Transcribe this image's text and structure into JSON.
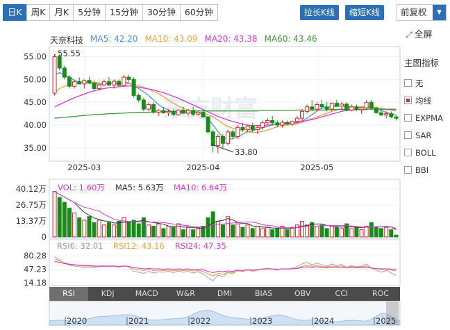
{
  "toolbar": {
    "periods": [
      "日K",
      "周K",
      "月K",
      "5分钟",
      "15分钟",
      "30分钟",
      "60分钟"
    ],
    "active_period": "日K",
    "widen_label": "拉长K线",
    "narrow_label": "缩短K线",
    "adjust_label": "前复权",
    "fullscreen_label": "全屏"
  },
  "stock": {
    "name": "天奈科技",
    "ma5": "MA5: 42.20",
    "ma10": "MA10: 43.09",
    "ma20": "MA20: 43.38",
    "ma60": "MA60: 43.46"
  },
  "colors": {
    "up": "#d62728",
    "down": "#1a8a1a",
    "ma5": "#4a90d9",
    "ma10": "#e8a33d",
    "ma20": "#d63ad6",
    "ma60": "#3a9a3a",
    "accent": "#2b6fb6"
  },
  "indicators_panel": {
    "title": "主图指标",
    "items": [
      {
        "label": "无",
        "checked": false
      },
      {
        "label": "均线",
        "checked": true
      },
      {
        "label": "EXPMA",
        "checked": false
      },
      {
        "label": "SAR",
        "checked": false
      },
      {
        "label": "BOLL",
        "checked": false
      },
      {
        "label": "BBI",
        "checked": false
      }
    ]
  },
  "price_axis": {
    "ticks": [
      "55.00",
      "50.00",
      "45.00",
      "40.00",
      "35.00"
    ]
  },
  "date_axis": {
    "ticks": [
      "2025-03",
      "2025-04",
      "2025-05"
    ]
  },
  "annotations": {
    "high": "55.55",
    "low": "33.80"
  },
  "volume": {
    "vol": "VOL: 1.60万",
    "ma5": "MA5: 5.63万",
    "ma10": "MA10: 6.64万",
    "ticks": [
      "40.12万",
      "26.75万",
      "13.37万",
      "0"
    ]
  },
  "rsi": {
    "rsi6": "RSI6: 32.01",
    "rsi12": "RSI12: 43.16",
    "rsi24": "RSI24: 47.35",
    "ticks": [
      "80.28",
      "47.23",
      "14.18"
    ]
  },
  "indicator_tabs": [
    "RSI",
    "KDJ",
    "MACD",
    "W&R",
    "DMI",
    "BIAS",
    "OBV",
    "CCI",
    "ROC"
  ],
  "active_indicator": "RSI",
  "timeline": {
    "years": [
      "2020",
      "2021",
      "2022",
      "2023",
      "2024",
      "2025"
    ]
  },
  "watermark": "东方财富",
  "chart_data": {
    "type": "candlestick",
    "title": "天奈科技",
    "ylim": [
      33,
      56
    ],
    "xlabels": [
      "2025-03",
      "2025-04",
      "2025-05"
    ],
    "ohlc": [
      [
        47.0,
        55.5,
        46.5,
        55.0
      ],
      [
        55.0,
        55.55,
        52.0,
        52.5
      ],
      [
        52.5,
        53.0,
        50.0,
        50.5
      ],
      [
        50.5,
        51.0,
        48.0,
        48.5
      ],
      [
        48.5,
        50.0,
        48.0,
        49.5
      ],
      [
        49.5,
        50.5,
        49.0,
        49.0
      ],
      [
        49.0,
        50.0,
        48.0,
        49.8
      ],
      [
        49.8,
        50.5,
        49.0,
        49.2
      ],
      [
        49.2,
        49.8,
        47.5,
        48.0
      ],
      [
        48.0,
        49.0,
        47.5,
        48.8
      ],
      [
        48.8,
        50.0,
        48.5,
        49.5
      ],
      [
        49.5,
        50.5,
        48.5,
        48.8
      ],
      [
        48.8,
        50.0,
        48.0,
        49.6
      ],
      [
        49.6,
        50.0,
        48.5,
        48.7
      ],
      [
        48.7,
        51.0,
        48.5,
        50.5
      ],
      [
        50.5,
        51.0,
        49.5,
        50.0
      ],
      [
        50.0,
        50.5,
        46.0,
        46.5
      ],
      [
        46.5,
        47.0,
        45.0,
        45.5
      ],
      [
        45.5,
        46.0,
        43.0,
        43.5
      ],
      [
        43.5,
        45.0,
        43.0,
        44.5
      ],
      [
        44.5,
        45.0,
        42.5,
        42.8
      ],
      [
        42.8,
        43.5,
        42.0,
        43.2
      ],
      [
        43.2,
        44.0,
        42.5,
        42.7
      ],
      [
        42.7,
        43.5,
        42.0,
        43.0
      ],
      [
        43.0,
        43.5,
        42.0,
        42.3
      ],
      [
        42.3,
        43.5,
        42.0,
        43.3
      ],
      [
        43.3,
        44.0,
        42.5,
        42.6
      ],
      [
        42.6,
        43.5,
        42.0,
        43.2
      ],
      [
        43.2,
        44.0,
        42.0,
        42.4
      ],
      [
        42.4,
        43.0,
        42.0,
        42.8
      ],
      [
        42.8,
        43.5,
        41.5,
        41.8
      ],
      [
        41.8,
        42.0,
        38.0,
        38.5
      ],
      [
        38.5,
        39.0,
        34.0,
        35.5
      ],
      [
        35.5,
        38.0,
        33.8,
        37.5
      ],
      [
        37.5,
        38.0,
        35.0,
        36.0
      ],
      [
        36.0,
        39.0,
        35.5,
        38.5
      ],
      [
        38.5,
        39.0,
        37.0,
        37.5
      ],
      [
        37.5,
        40.0,
        37.0,
        39.5
      ],
      [
        39.5,
        40.5,
        38.5,
        39.0
      ],
      [
        39.0,
        40.0,
        38.5,
        39.8
      ],
      [
        39.8,
        40.5,
        38.5,
        39.0
      ],
      [
        39.0,
        40.0,
        38.0,
        39.5
      ],
      [
        39.5,
        41.0,
        39.0,
        40.5
      ],
      [
        40.5,
        41.5,
        40.0,
        41.0
      ],
      [
        41.0,
        42.0,
        40.0,
        40.5
      ],
      [
        40.5,
        41.0,
        39.5,
        40.0
      ],
      [
        40.0,
        41.0,
        39.5,
        40.6
      ],
      [
        40.6,
        41.0,
        40.0,
        40.2
      ],
      [
        40.2,
        41.0,
        39.8,
        40.8
      ],
      [
        40.8,
        42.0,
        40.5,
        41.5
      ],
      [
        41.5,
        43.5,
        41.0,
        43.0
      ],
      [
        43.0,
        44.5,
        42.5,
        44.0
      ],
      [
        44.0,
        45.5,
        43.0,
        43.5
      ],
      [
        43.5,
        45.0,
        43.0,
        44.5
      ],
      [
        44.5,
        45.5,
        43.5,
        44.0
      ],
      [
        44.0,
        45.0,
        43.0,
        43.5
      ],
      [
        43.5,
        45.0,
        43.0,
        44.8
      ],
      [
        44.8,
        45.5,
        44.0,
        44.2
      ],
      [
        44.2,
        45.0,
        43.5,
        44.6
      ],
      [
        44.6,
        45.0,
        43.0,
        43.3
      ],
      [
        43.3,
        44.5,
        43.0,
        44.0
      ],
      [
        44.0,
        44.5,
        43.0,
        43.4
      ],
      [
        43.4,
        44.0,
        42.5,
        43.8
      ],
      [
        43.8,
        45.5,
        43.5,
        45.0
      ],
      [
        45.0,
        45.5,
        43.5,
        43.7
      ],
      [
        43.7,
        44.0,
        42.5,
        42.7
      ],
      [
        42.7,
        43.5,
        42.0,
        42.2
      ],
      [
        42.2,
        43.0,
        41.5,
        42.5
      ],
      [
        42.5,
        43.0,
        41.5,
        41.8
      ],
      [
        41.8,
        42.2,
        41.0,
        41.5
      ]
    ],
    "series": [
      {
        "name": "MA5",
        "values": [
          51,
          51.5,
          51,
          50.5,
          49.8,
          49.5,
          49.3,
          49.2,
          49.1,
          49.0,
          49.0,
          49.1,
          49.1,
          49.1,
          49.3,
          49.3,
          48.6,
          48.0,
          47.3,
          46.5,
          45.5,
          44.5,
          43.8,
          43.3,
          42.9,
          42.8,
          42.8,
          42.8,
          42.8,
          42.7,
          42.5,
          41.5,
          40.0,
          38.6,
          37.3,
          36.9,
          37.0,
          37.5,
          38.0,
          38.5,
          38.8,
          39.1,
          39.4,
          39.7,
          40.0,
          40.2,
          40.4,
          40.5,
          40.4,
          40.5,
          40.9,
          41.5,
          42.3,
          43.1,
          43.7,
          43.9,
          44.0,
          44.1,
          44.2,
          44.1,
          44.0,
          43.9,
          43.8,
          43.9,
          43.9,
          43.6,
          43.2,
          42.8,
          42.5,
          42.2
        ]
      },
      {
        "name": "MA10",
        "values": [
          47,
          48,
          48.5,
          49,
          49.2,
          49.4,
          49.5,
          49.5,
          49.4,
          49.3,
          49.2,
          49.2,
          49.2,
          49.2,
          49.1,
          49.1,
          48.9,
          48.6,
          48.3,
          47.9,
          47.4,
          46.9,
          46.2,
          45.5,
          44.8,
          44.2,
          43.7,
          43.3,
          43.0,
          42.8,
          42.6,
          42.3,
          41.8,
          41.1,
          40.3,
          39.7,
          39.3,
          39.0,
          38.8,
          38.5,
          38.4,
          38.4,
          38.6,
          38.9,
          39.3,
          39.6,
          39.9,
          40.0,
          40.1,
          40.3,
          40.6,
          41.0,
          41.4,
          41.8,
          42.2,
          42.6,
          43.0,
          43.3,
          43.6,
          43.9,
          44.0,
          44.0,
          44.0,
          44.0,
          44.0,
          43.9,
          43.7,
          43.5,
          43.3,
          43.09
        ]
      },
      {
        "name": "MA20",
        "values": [
          44,
          44.5,
          45,
          45.5,
          46,
          46.4,
          46.8,
          47.2,
          47.5,
          47.8,
          48.0,
          48.2,
          48.3,
          48.4,
          48.5,
          48.6,
          48.5,
          48.3,
          48.1,
          47.9,
          47.7,
          47.4,
          47.1,
          46.7,
          46.3,
          45.9,
          45.4,
          44.9,
          44.4,
          43.9,
          43.4,
          42.9,
          42.4,
          41.9,
          41.5,
          41.1,
          40.8,
          40.5,
          40.2,
          40.0,
          39.9,
          39.9,
          39.9,
          40.0,
          40.1,
          40.2,
          40.3,
          40.4,
          40.5,
          40.6,
          40.8,
          41.0,
          41.2,
          41.5,
          41.8,
          42.1,
          42.4,
          42.7,
          43.0,
          43.2,
          43.3,
          43.4,
          43.4,
          43.5,
          43.5,
          43.5,
          43.5,
          43.4,
          43.4,
          43.38
        ]
      },
      {
        "name": "MA60",
        "values": [
          41.5,
          41.6,
          41.7,
          41.8,
          41.9,
          42.0,
          42.1,
          42.2,
          42.3,
          42.3,
          42.4,
          42.5,
          42.5,
          42.6,
          42.6,
          42.7,
          42.7,
          42.8,
          42.8,
          42.8,
          42.9,
          42.9,
          42.9,
          43.0,
          43.0,
          43.0,
          43.0,
          43.1,
          43.1,
          43.1,
          43.1,
          43.1,
          43.1,
          43.1,
          43.1,
          43.1,
          43.1,
          43.1,
          43.1,
          43.1,
          43.1,
          43.1,
          43.2,
          43.2,
          43.2,
          43.2,
          43.2,
          43.2,
          43.2,
          43.3,
          43.3,
          43.3,
          43.3,
          43.3,
          43.3,
          43.3,
          43.4,
          43.4,
          43.4,
          43.4,
          43.4,
          43.4,
          43.4,
          43.4,
          43.5,
          43.5,
          43.5,
          43.5,
          43.5,
          43.46
        ]
      }
    ],
    "volume": [
      38,
      33,
      29,
      24,
      20,
      16,
      14,
      17,
      12,
      14,
      10,
      12,
      10,
      13,
      16,
      12,
      14,
      11,
      16,
      10,
      9,
      11,
      7,
      9,
      8,
      11,
      6,
      8,
      6,
      7,
      9,
      16,
      21,
      13,
      10,
      17,
      10,
      11,
      8,
      10,
      7,
      9,
      7,
      8,
      6,
      7,
      9,
      6,
      8,
      10,
      13,
      10,
      12,
      9,
      10,
      7,
      9,
      8,
      7,
      11,
      7,
      8,
      6,
      9,
      12,
      8,
      7,
      8,
      6,
      1.6
    ],
    "rsi": {
      "rsi6": [
        78,
        70,
        62,
        57,
        55,
        53,
        52,
        52,
        51,
        53,
        54,
        53,
        54,
        52,
        55,
        53,
        42,
        40,
        37,
        42,
        38,
        41,
        40,
        42,
        39,
        43,
        40,
        42,
        38,
        41,
        36,
        26,
        19,
        33,
        29,
        39,
        36,
        44,
        41,
        46,
        42,
        45,
        48,
        50,
        47,
        45,
        49,
        47,
        50,
        54,
        60,
        64,
        58,
        62,
        58,
        55,
        60,
        56,
        59,
        52,
        56,
        53,
        55,
        60,
        50,
        44,
        40,
        44,
        38,
        32
      ],
      "rsi12": [
        72,
        68,
        63,
        60,
        58,
        56,
        55,
        55,
        54,
        55,
        55,
        54,
        55,
        54,
        55,
        54,
        48,
        46,
        44,
        46,
        44,
        45,
        44,
        45,
        43,
        45,
        44,
        45,
        43,
        44,
        42,
        36,
        31,
        37,
        35,
        40,
        39,
        43,
        42,
        45,
        43,
        45,
        47,
        48,
        47,
        46,
        48,
        47,
        48,
        50,
        54,
        57,
        54,
        56,
        54,
        53,
        55,
        54,
        55,
        52,
        54,
        52,
        53,
        55,
        51,
        48,
        46,
        47,
        45,
        43.16
      ]
    },
    "rsi24_values": [
      66,
      64,
      61,
      59,
      58,
      57,
      56,
      56,
      55,
      55,
      55,
      55,
      55,
      54,
      55,
      54,
      51,
      50,
      48,
      49,
      48,
      48,
      47,
      48,
      47,
      48,
      47,
      48,
      46,
      47,
      46,
      42,
      39,
      42,
      41,
      43,
      42,
      45,
      44,
      46,
      45,
      46,
      47,
      48,
      48,
      47,
      48,
      48,
      48,
      49,
      52,
      53,
      52,
      53,
      52,
      51,
      52,
      52,
      52,
      51,
      52,
      51,
      51,
      52,
      50,
      49,
      48,
      48,
      47.5,
      47.35
    ]
  }
}
